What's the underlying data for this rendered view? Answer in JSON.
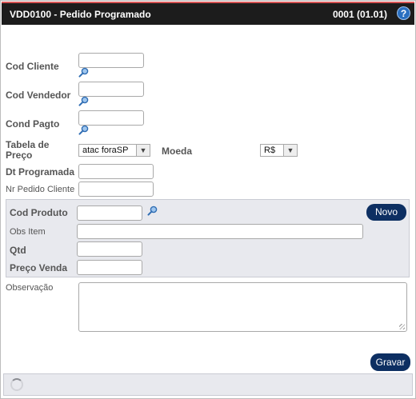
{
  "window": {
    "title": "VDD0100 - Pedido Programado",
    "version": "0001 (01.01)",
    "help_glyph": "?"
  },
  "form": {
    "cod_cliente": {
      "label": "Cod Cliente",
      "value": ""
    },
    "cod_vendedor": {
      "label": "Cod Vendedor",
      "value": ""
    },
    "cond_pagto": {
      "label": "Cond Pagto",
      "value": ""
    },
    "tabela_preco": {
      "label_line1": "Tabela de",
      "label_line2": "Preço",
      "selected": "atac foraSP"
    },
    "moeda": {
      "label": "Moeda",
      "selected": "R$"
    },
    "dt_programada": {
      "label": "Dt Programada",
      "value": ""
    },
    "nr_pedido_cliente": {
      "label": "Nr Pedido Cliente",
      "value": ""
    },
    "observacao": {
      "label": "Observação",
      "value": ""
    }
  },
  "item_panel": {
    "cod_produto": {
      "label": "Cod Produto",
      "value": ""
    },
    "obs_item": {
      "label": "Obs Item",
      "value": ""
    },
    "qtd": {
      "label": "Qtd",
      "value": ""
    },
    "preco_venda": {
      "label": "Preço Venda",
      "value": ""
    },
    "novo_label": "Novo"
  },
  "actions": {
    "gravar_label": "Gravar"
  },
  "colors": {
    "title_bg": "#1c1c1c",
    "title_accent": "#d75454",
    "button_bg": "#0d2f62",
    "panel_bg": "#e8e9ee"
  },
  "icons": {
    "lookup": "magnifier-icon",
    "help": "help-icon",
    "loading": "spinner-icon"
  }
}
